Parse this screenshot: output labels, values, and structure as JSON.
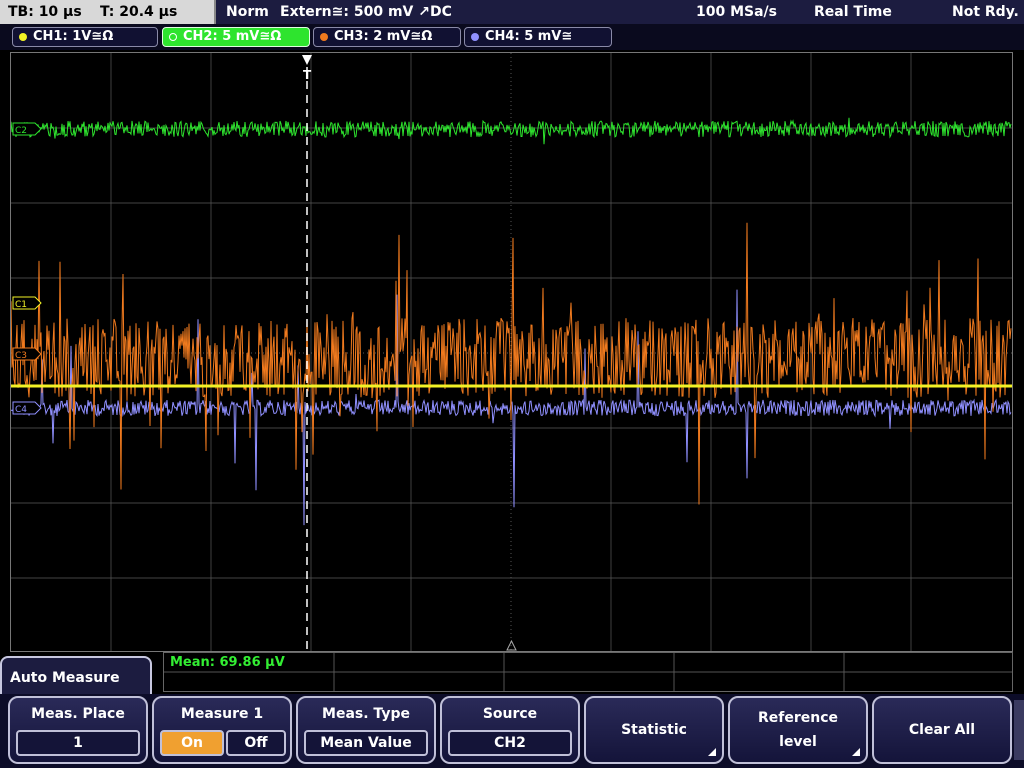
{
  "topbar": {
    "timebase": "TB: 10 µs",
    "trigger_time": "T: 20.4 µs",
    "mode": "Norm",
    "trigger_source": "Extern≅: 500 mV ↗DC",
    "sample_rate": "100 MSa/s",
    "acq_mode": "Real Time",
    "status": "Not Rdy."
  },
  "channels": [
    {
      "label": "CH1: 1V≅Ω",
      "color": "#f2f226"
    },
    {
      "label": "CH2: 5 mV≅Ω",
      "color": "#2ee42e"
    },
    {
      "label": "CH3: 2 mV≅Ω",
      "color": "#f07a1e"
    },
    {
      "label": "CH4: 5 mV≅",
      "color": "#9090ff"
    }
  ],
  "channel_markers": [
    "C2",
    "C1",
    "C3",
    "C4"
  ],
  "trigger_marker": "T",
  "measurement": {
    "result": "Mean: 69.86 µV"
  },
  "menu": {
    "title": "Auto Measure",
    "meas_place_label": "Meas. Place",
    "meas_place_value": "1",
    "measure1_label": "Measure 1",
    "on_label": "On",
    "off_label": "Off",
    "meas_type_label": "Meas. Type",
    "meas_type_value": "Mean Value",
    "source_label": "Source",
    "source_value": "CH2",
    "statistic_label": "Statistic",
    "reference_label_1": "Reference",
    "reference_label_2": "level",
    "clear_all_label": "Clear All"
  },
  "colors": {
    "ch1": "#f2f226",
    "ch2": "#2ee42e",
    "ch3": "#f07a1e",
    "ch4": "#9090ff",
    "grid": "#5a5a5a",
    "accent_on": "#f0a030"
  }
}
